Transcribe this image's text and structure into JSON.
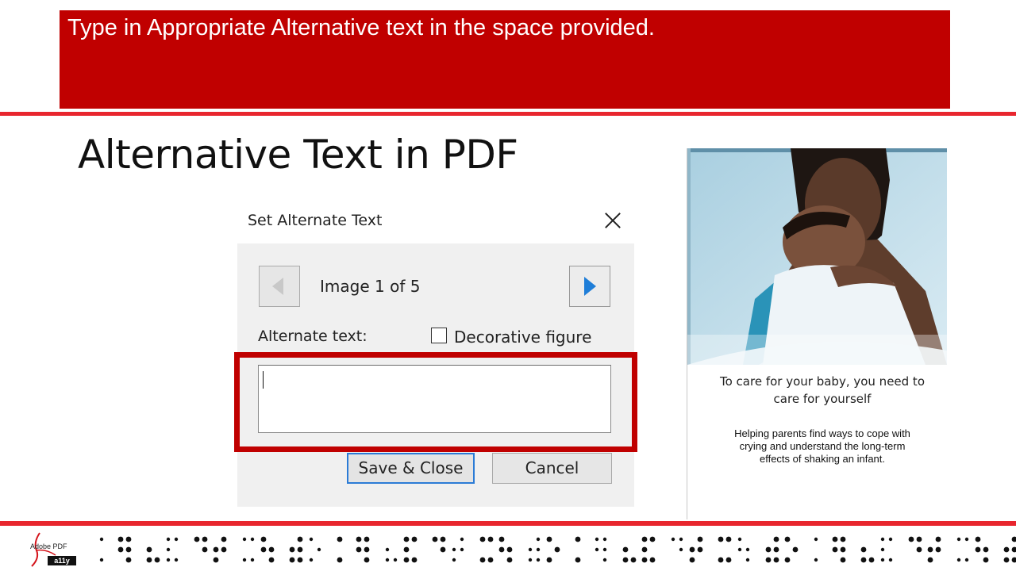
{
  "banner": {
    "instruction": "Type in Appropriate Alternative text in the space provided."
  },
  "slide": {
    "title": "Alternative Text in PDF"
  },
  "dialog": {
    "title": "Set Alternate Text",
    "close_icon": "close-icon",
    "image_counter": "Image 1 of 5",
    "alt_text_label": "Alternate text:",
    "alt_text_value": "",
    "decorative_label": "Decorative figure",
    "decorative_checked": false,
    "save_label": "Save & Close",
    "cancel_label": "Cancel",
    "prev_icon": "triangle-left-icon",
    "next_icon": "triangle-right-icon"
  },
  "flyer": {
    "heading_line1": "To care for your baby, you need to",
    "heading_line2": "care for yourself",
    "sub_line1": "Helping parents find ways to cope with",
    "sub_line2": "crying and understand the long-term",
    "sub_line3": "effects of shaking an infant."
  },
  "footer": {
    "logo_text": "Adobe PDF",
    "logo_badge": "a11y"
  },
  "colors": {
    "banner_red": "#c00000",
    "rule_red": "#e8262e",
    "highlight_red": "#c00000",
    "focus_blue": "#2b7bd6",
    "next_arrow_blue": "#1f7ed8"
  }
}
